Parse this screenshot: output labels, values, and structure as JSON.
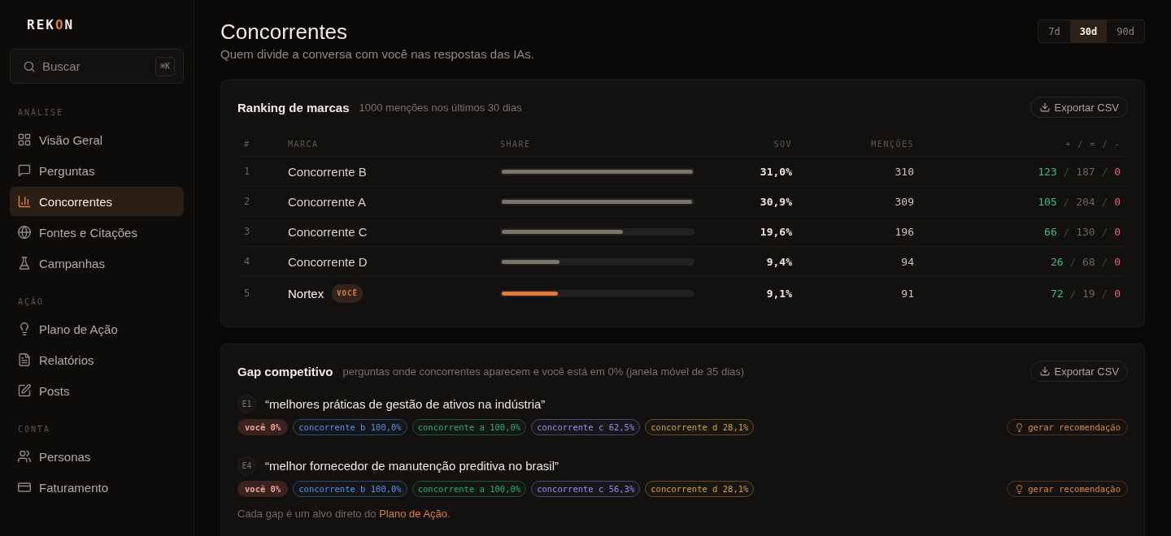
{
  "sidebar": {
    "logo": [
      {
        "text": "REK",
        "accent": false
      },
      {
        "text": "O",
        "accent": true
      },
      {
        "text": "N",
        "accent": false
      }
    ],
    "search": {
      "placeholder": "Buscar",
      "shortcut": "⌘K"
    },
    "sections": [
      {
        "label": "ANÁLISE",
        "items": [
          {
            "label": "Visão Geral",
            "selected": false
          },
          {
            "label": "Perguntas",
            "selected": false
          },
          {
            "label": "Concorrentes",
            "selected": true
          },
          {
            "label": "Fontes e Citações",
            "selected": false
          },
          {
            "label": "Campanhas",
            "selected": false
          }
        ]
      },
      {
        "label": "AÇÃO",
        "items": [
          {
            "label": "Plano de Ação",
            "selected": false
          },
          {
            "label": "Relatórios",
            "selected": false
          },
          {
            "label": "Posts",
            "selected": false
          }
        ]
      },
      {
        "label": "CONTA",
        "items": [
          {
            "label": "Personas",
            "selected": false
          },
          {
            "label": "Faturamento",
            "selected": false
          }
        ]
      }
    ]
  },
  "header": {
    "title": "Concorrentes",
    "subtitle": "Quem divide a conversa com você nas respostas das IAs.",
    "periods": [
      {
        "label": "7d",
        "selected": false
      },
      {
        "label": "30d",
        "selected": true
      },
      {
        "label": "90d",
        "selected": false
      }
    ]
  },
  "ranking": {
    "title": "Ranking de marcas",
    "subtitle": "1000 menções nos últimos 30 dias",
    "export_label": "Exportar CSV",
    "columns": [
      "#",
      "MARCA",
      "SHARE",
      "SOV",
      "MENÇÕES",
      "+ / = / -"
    ],
    "rows": [
      {
        "rank": "1",
        "brand": "Concorrente B",
        "self": false,
        "level": 1.0,
        "sov": "31,0%",
        "mentions": "310",
        "breakdown": [
          {
            "text": "123",
            "kind": "positive"
          },
          {
            "text": "/",
            "kind": "separator"
          },
          {
            "text": "187",
            "kind": "neutral"
          },
          {
            "text": "/",
            "kind": "separator"
          },
          {
            "text": "0",
            "kind": "negative"
          }
        ]
      },
      {
        "rank": "2",
        "brand": "Concorrente A",
        "self": false,
        "level": 0.997,
        "sov": "30,9%",
        "mentions": "309",
        "breakdown": [
          {
            "text": "105",
            "kind": "positive"
          },
          {
            "text": "/",
            "kind": "separator"
          },
          {
            "text": "204",
            "kind": "neutral"
          },
          {
            "text": "/",
            "kind": "separator"
          },
          {
            "text": "0",
            "kind": "negative"
          }
        ]
      },
      {
        "rank": "3",
        "brand": "Concorrente C",
        "self": false,
        "level": 0.632,
        "sov": "19,6%",
        "mentions": "196",
        "breakdown": [
          {
            "text": "66",
            "kind": "positive"
          },
          {
            "text": "/",
            "kind": "separator"
          },
          {
            "text": "130",
            "kind": "neutral"
          },
          {
            "text": "/",
            "kind": "separator"
          },
          {
            "text": "0",
            "kind": "negative"
          }
        ]
      },
      {
        "rank": "4",
        "brand": "Concorrente D",
        "self": false,
        "level": 0.303,
        "sov": "9,4%",
        "mentions": "94",
        "breakdown": [
          {
            "text": "26",
            "kind": "positive"
          },
          {
            "text": "/",
            "kind": "separator"
          },
          {
            "text": "68",
            "kind": "neutral"
          },
          {
            "text": "/",
            "kind": "separator"
          },
          {
            "text": "0",
            "kind": "negative"
          }
        ]
      },
      {
        "rank": "5",
        "brand": "Nortex",
        "badge": "VOCÊ",
        "self": true,
        "level": 0.294,
        "sov": "9,1%",
        "mentions": "91",
        "breakdown": [
          {
            "text": "72",
            "kind": "positive"
          },
          {
            "text": "/",
            "kind": "separator"
          },
          {
            "text": "19",
            "kind": "neutral"
          },
          {
            "text": "/",
            "kind": "separator"
          },
          {
            "text": "0",
            "kind": "negative"
          }
        ]
      }
    ]
  },
  "gap": {
    "title": "Gap competitivo",
    "subtitle": "perguntas onde concorrentes aparecem e você está em 0% (janela móvel de 35 dias)",
    "export_label": "Exportar CSV",
    "items": [
      {
        "id": "E1",
        "question": "“melhores práticas de gestão de ativos na indústria”",
        "tags": [
          {
            "text": "você 0%",
            "kind": "self",
            "color": "#3a2220"
          },
          {
            "text": "concorrente b 100,0%",
            "kind": "competitor",
            "color": "#5a8fe6"
          },
          {
            "text": "concorrente a 100,0%",
            "kind": "competitor",
            "color": "#35a878"
          },
          {
            "text": "concorrente c 62,5%",
            "kind": "competitor",
            "color": "#9a8cf2"
          },
          {
            "text": "concorrente d 28,1%",
            "kind": "competitor",
            "color": "#d4a048"
          }
        ],
        "action": "gerar recomendação"
      },
      {
        "id": "E4",
        "question": "“melhor fornecedor de manutenção preditiva no brasil”",
        "tags": [
          {
            "text": "você 0%",
            "kind": "self",
            "color": "#3a2220"
          },
          {
            "text": "concorrente b 100,0%",
            "kind": "competitor",
            "color": "#5a8fe6"
          },
          {
            "text": "concorrente a 100,0%",
            "kind": "competitor",
            "color": "#35a878"
          },
          {
            "text": "concorrente c 56,3%",
            "kind": "competitor",
            "color": "#9a8cf2"
          },
          {
            "text": "concorrente d 28,1%",
            "kind": "competitor",
            "color": "#d4a048"
          }
        ],
        "action": "gerar recomendação"
      }
    ],
    "footer": {
      "text": "Cada gap é um alvo direto do",
      "link": "Plano de Ação",
      "end": "."
    }
  }
}
